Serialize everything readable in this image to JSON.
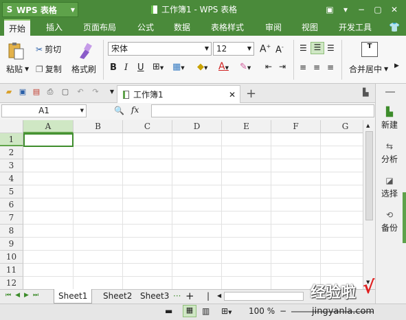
{
  "app": {
    "name": "WPS 表格",
    "doc_title": "工作簿1 - WPS 表格"
  },
  "menu_tabs": [
    "开始",
    "插入",
    "页面布局",
    "公式",
    "数据",
    "表格样式",
    "审阅",
    "视图",
    "开发工具"
  ],
  "ribbon": {
    "paste": "粘贴",
    "cut": "剪切",
    "copy": "复制",
    "format_painter": "格式刷",
    "font_name": "宋体",
    "font_size": "12",
    "merge_center": "合并居中"
  },
  "doc_tab": "工作簿1",
  "formula_bar": {
    "name_box": "A1",
    "fx": "fx",
    "content": ""
  },
  "grid": {
    "columns": [
      "A",
      "B",
      "C",
      "D",
      "E",
      "F",
      "G"
    ],
    "rows": [
      "1",
      "2",
      "3",
      "4",
      "5",
      "6",
      "7",
      "8",
      "9",
      "10",
      "11",
      "12"
    ],
    "selected_cell": "A1"
  },
  "sheets": [
    "Sheet1",
    "Sheet2",
    "Sheet3"
  ],
  "active_sheet": "Sheet1",
  "status": {
    "zoom": "100 %"
  },
  "side_panel": [
    "新建",
    "分析",
    "选择",
    "备份"
  ],
  "watermark": {
    "text": "经验啦",
    "url": "jingyanla.com"
  },
  "colors": {
    "title_green": "#4a8a3a",
    "accent_green": "#5ea24a",
    "selection": "#3d8c2b"
  }
}
